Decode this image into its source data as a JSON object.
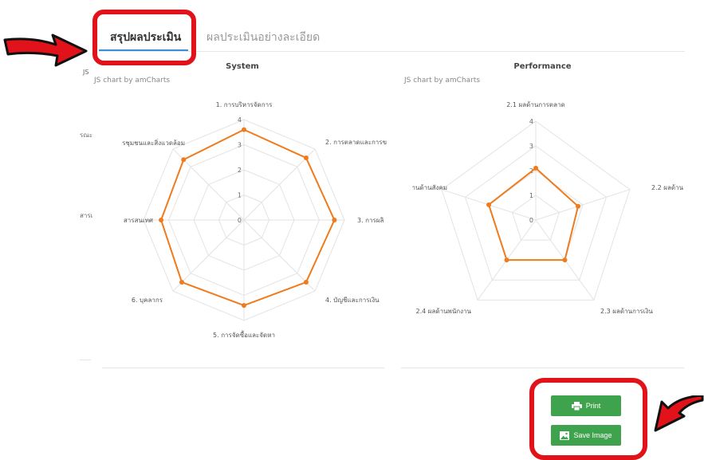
{
  "tabs": [
    {
      "label": "สรุปผลประเมิน",
      "active": true
    },
    {
      "label": "ผลประเมินอย่างละเอียด",
      "active": false
    }
  ],
  "left_fragments": [
    "JS",
    "รณะ",
    "สารเ"
  ],
  "buttons": {
    "print": "Print",
    "save_image": "Save Image"
  },
  "colors": {
    "accent": "#3a8fd8",
    "series": "#f07b1d",
    "button": "#3fa34d",
    "highlight": "#e2121a"
  },
  "chart_data": [
    {
      "type": "radar",
      "title": "System",
      "credit": "JS chart by amCharts",
      "categories": [
        "1. การบริหารจัดการ",
        "2. การตลาดและการข",
        "3. การผลิ",
        "4. บัญชีและการเงิน",
        "5. การจัดซื้อและจัดหา",
        "6. บุคลากร",
        "สารสนเทศ",
        "รชุมชนและสิ่งแวดล้อม"
      ],
      "values": [
        3.6,
        3.5,
        3.6,
        3.5,
        3.4,
        3.5,
        3.3,
        3.4
      ],
      "axis_ticks": [
        "0",
        "1",
        "2",
        "3",
        "4"
      ],
      "ylim": [
        0,
        4
      ],
      "grid": true
    },
    {
      "type": "radar",
      "title": "Performance",
      "credit": "JS chart by amCharts",
      "categories": [
        "2.1 ผลด้านการตลาด",
        "2.2 ผลด้าน",
        "2.3 ผลด้านการเงิน",
        "2.4 ผลด้านพนักงาน",
        "านด้านสังคม"
      ],
      "values": [
        2.1,
        1.8,
        2.0,
        2.0,
        2.0
      ],
      "axis_ticks": [
        "0",
        "1",
        "2",
        "3",
        "4"
      ],
      "ylim": [
        0,
        4
      ],
      "grid": true
    }
  ]
}
